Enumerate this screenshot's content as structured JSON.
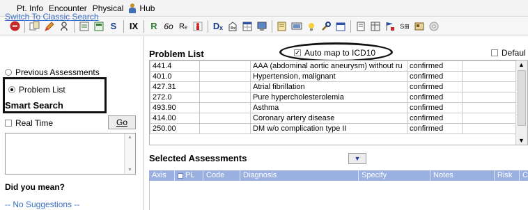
{
  "menubar": {
    "items": [
      "Pt. Info",
      "Encounter",
      "Physical",
      "Hub"
    ]
  },
  "toolbar": {
    "icons": [
      "stop-icon",
      "copy-icon",
      "pencil-icon",
      "user-icon",
      "notes-icon",
      "calc-icon",
      "s-icon",
      "ix-icon",
      "rx-icon",
      "glasses-icon",
      "re-icon",
      "figure-icon",
      "dx-icon",
      "rx-box-icon",
      "grid-icon",
      "computer-icon",
      "doc-icon",
      "monitor-icon",
      "lamp-icon",
      "wrench-icon",
      "calendar-icon",
      "page-icon",
      "table-icon",
      "flag-icon",
      "list-icon",
      "scan-icon",
      "disc-icon"
    ]
  },
  "left": {
    "classic_link": "Switch To Classic Search",
    "radio_previous": "Previous Assessments",
    "radio_problem": "Problem List",
    "smart_search": "Smart Search",
    "real_time": "Real Time",
    "go": "Go",
    "did_you_mean": "Did you mean?",
    "no_suggestions": "-- No Suggestions --"
  },
  "problem_list": {
    "title": "Problem List",
    "auto_map": "Auto map to ICD10",
    "auto_map_checked": true,
    "default_label": "Defaul",
    "rows": [
      {
        "code": "441.4",
        "desc": "AAA (abdominal aortic aneurysm) without ru",
        "status": "confirmed"
      },
      {
        "code": "401.0",
        "desc": "Hypertension, malignant",
        "status": "confirmed"
      },
      {
        "code": "427.31",
        "desc": "Atrial fibrillation",
        "status": "confirmed"
      },
      {
        "code": "272.0",
        "desc": "Pure hypercholesterolemia",
        "status": "confirmed"
      },
      {
        "code": "493.90",
        "desc": "Asthma",
        "status": "confirmed"
      },
      {
        "code": "414.00",
        "desc": "Coronary artery disease",
        "status": "confirmed"
      },
      {
        "code": "250.00",
        "desc": "DM w/o complication type II",
        "status": "confirmed"
      }
    ]
  },
  "selected_assessments": {
    "title": "Selected Assessments",
    "columns": [
      "Axis",
      "PL",
      "Code",
      "Diagnosis",
      "Specify",
      "Notes",
      "Risk",
      "C"
    ]
  }
}
